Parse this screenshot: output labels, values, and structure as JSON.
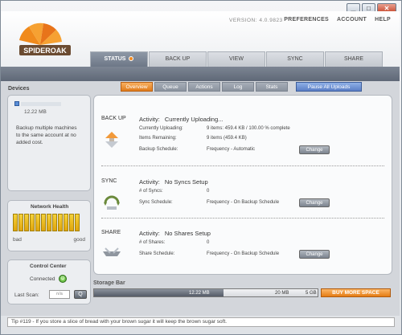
{
  "window": {
    "minimize": "▁",
    "maximize": "□",
    "close": "✕"
  },
  "header": {
    "version": "VERSION: 4.0.9823",
    "nav": [
      "PREFERENCES",
      "ACCOUNT",
      "HELP"
    ],
    "logo_text": "SPIDEROAK"
  },
  "tabs": [
    {
      "label": "STATUS",
      "active": true
    },
    {
      "label": "BACK UP"
    },
    {
      "label": "VIEW"
    },
    {
      "label": "SYNC"
    },
    {
      "label": "SHARE"
    }
  ],
  "subtabs": [
    {
      "label": "Overview",
      "active": true
    },
    {
      "label": "Queue"
    },
    {
      "label": "Actions"
    },
    {
      "label": "Log"
    },
    {
      "label": "Stats"
    }
  ],
  "pause_button": "Pause All Uploads",
  "devices": {
    "title": "Devices",
    "size": "12.22 MB",
    "message": "Backup multiple machines to the same account at no added cost."
  },
  "network_health": {
    "title": "Network Health",
    "low_label": "bad",
    "high_label": "good",
    "bars_total": 12,
    "bars_filled": 12
  },
  "control_center": {
    "title": "Control Center",
    "status": "Connected",
    "last_scan_label": "Last Scan:",
    "last_scan_value": "n/a",
    "scan_button": "Q"
  },
  "backup": {
    "label": "BACK UP",
    "activity_label": "Activity:",
    "activity": "Currently Uploading...",
    "currently_uploading_label": "Currently Uploading:",
    "currently_uploading": "9 items: 459.4 KB / 100.00 % complete",
    "items_remaining_label": "Items Remaining:",
    "items_remaining": "9 items (459.4 KB)",
    "schedule_label": "Backup Schedule:",
    "schedule": "Frequency - Automatic",
    "change": "Change"
  },
  "sync": {
    "label": "SYNC",
    "activity_label": "Activity:",
    "activity": "No Syncs Setup",
    "count_label": "# of Syncs:",
    "count": "0",
    "schedule_label": "Sync Schedule:",
    "schedule": "Frequency - On Backup Schedule",
    "change": "Change"
  },
  "share": {
    "label": "SHARE",
    "activity_label": "Activity:",
    "activity": "No Shares Setup",
    "count_label": "# of Shares:",
    "count": "0",
    "schedule_label": "Share Schedule:",
    "schedule": "Frequency - On Backup Schedule",
    "change": "Change"
  },
  "storage": {
    "title": "Storage Bar",
    "used": "12.22 MB",
    "marker": "20 MB",
    "total": "5 GB",
    "used_fraction": 0.58,
    "buy_label": "BUY MORE SPACE"
  },
  "tip": "Tip #119 - If you store a slice of bread with your brown sugar it will keep the brown sugar soft.",
  "colors": {
    "accent": "#e07b1a",
    "health": "#f5d23a",
    "connected": "#3e9c1e"
  }
}
